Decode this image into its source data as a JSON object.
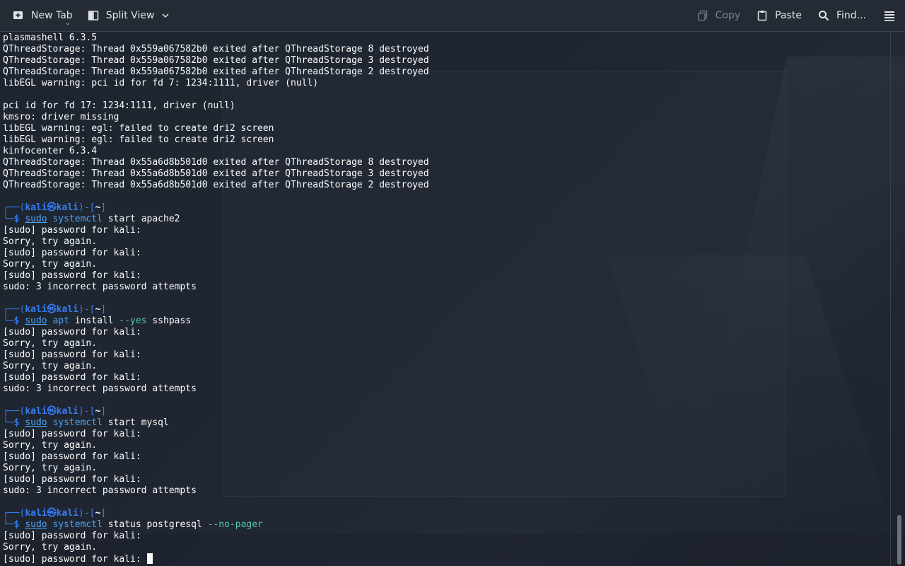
{
  "toolbar": {
    "new_tab_label": "New Tab",
    "split_view_label": "Split View",
    "copy_label": "Copy",
    "paste_label": "Paste",
    "find_label": "Find...",
    "icons": [
      "new-tab-icon",
      "split-view-icon",
      "chevron-down-icon",
      "copy-icon",
      "paste-icon",
      "search-icon",
      "hamburger-menu-icon"
    ]
  },
  "prompt": {
    "frame_top": "┌──(",
    "user": "kali",
    "at": "㉿",
    "host": "kali",
    "mid": ")-[",
    "path": "~",
    "end": "]",
    "frame_bottom": "└─",
    "dollar": "$"
  },
  "terminal": {
    "header_lines": [
      "plasmashell 6.3.5",
      "QThreadStorage: Thread 0x559a067582b0 exited after QThreadStorage 8 destroyed",
      "QThreadStorage: Thread 0x559a067582b0 exited after QThreadStorage 3 destroyed",
      "QThreadStorage: Thread 0x559a067582b0 exited after QThreadStorage 2 destroyed",
      "libEGL warning: pci id for fd 7: 1234:1111, driver (null)",
      "",
      "pci id for fd 17: 1234:1111, driver (null)",
      "kmsro: driver missing",
      "libEGL warning: egl: failed to create dri2 screen",
      "libEGL warning: egl: failed to create dri2 screen",
      "kinfocenter 6.3.4",
      "QThreadStorage: Thread 0x55a6d8b501d0 exited after QThreadStorage 8 destroyed",
      "QThreadStorage: Thread 0x55a6d8b501d0 exited after QThreadStorage 3 destroyed",
      "QThreadStorage: Thread 0x55a6d8b501d0 exited after QThreadStorage 2 destroyed",
      ""
    ],
    "sessions": [
      {
        "sudo": "sudo",
        "cmd": "systemctl",
        "args": " start apache2",
        "opt": "",
        "output": [
          "[sudo] password for kali:",
          "Sorry, try again.",
          "[sudo] password for kali:",
          "Sorry, try again.",
          "[sudo] password for kali:",
          "sudo: 3 incorrect password attempts",
          ""
        ]
      },
      {
        "sudo": "sudo",
        "cmd": "apt",
        "args": " install ",
        "opt": "--yes",
        "args2": " sshpass",
        "output": [
          "[sudo] password for kali:",
          "Sorry, try again.",
          "[sudo] password for kali:",
          "Sorry, try again.",
          "[sudo] password for kali:",
          "sudo: 3 incorrect password attempts",
          ""
        ]
      },
      {
        "sudo": "sudo",
        "cmd": "systemctl",
        "args": " start mysql",
        "opt": "",
        "output": [
          "[sudo] password for kali:",
          "Sorry, try again.",
          "[sudo] password for kali:",
          "Sorry, try again.",
          "[sudo] password for kali:",
          "sudo: 3 incorrect password attempts",
          ""
        ]
      },
      {
        "sudo": "sudo",
        "cmd": "systemctl",
        "args": " status postgresql ",
        "opt": "--no-pager",
        "output": [
          "[sudo] password for kali:",
          "Sorry, try again."
        ]
      }
    ],
    "last_line": "[sudo] password for kali: "
  },
  "colors": {
    "background": "#1f2631",
    "toolbar": "#252b35",
    "prompt": "#367bf0",
    "command": "#4ea3f5",
    "option": "#55c7b0",
    "text": "#fcfcfc"
  }
}
